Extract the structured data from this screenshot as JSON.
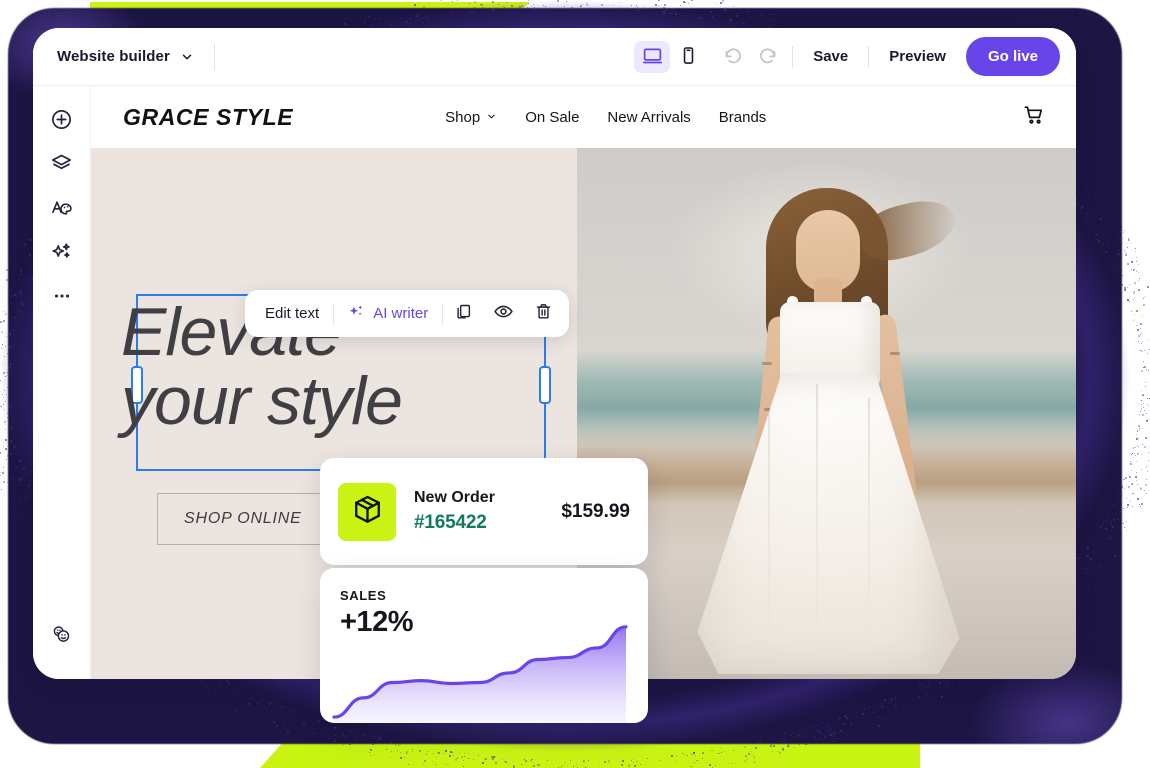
{
  "app": {
    "title": "Website builder",
    "title_chevron_icon": "chevron-down-icon"
  },
  "toolbar": {
    "desktop_view_icon": "desktop-monitor-icon",
    "mobile_view_icon": "mobile-phone-icon",
    "undo_icon": "undo-arrow-icon",
    "redo_icon": "redo-arrow-icon",
    "save_label": "Save",
    "preview_label": "Preview",
    "go_live_label": "Go live",
    "accent_color": "#6845e8",
    "active_view": "desktop"
  },
  "sidebar": {
    "items": [
      {
        "name": "add-element",
        "icon": "plus-circle-icon"
      },
      {
        "name": "layers",
        "icon": "layers-icon"
      },
      {
        "name": "design",
        "icon": "text-palette-icon"
      },
      {
        "name": "ai-tools",
        "icon": "sparkles-icon"
      },
      {
        "name": "more",
        "icon": "ellipsis-icon"
      }
    ],
    "bottom_item": {
      "name": "feedback",
      "icon": "smiley-faces-icon"
    }
  },
  "site": {
    "brand": "GRACE STYLE",
    "nav": [
      {
        "label": "Shop",
        "has_dropdown": true,
        "icon": "chevron-down-icon"
      },
      {
        "label": "On Sale",
        "has_dropdown": false
      },
      {
        "label": "New Arrivals",
        "has_dropdown": false
      },
      {
        "label": "Brands",
        "has_dropdown": false
      }
    ],
    "cart_icon": "shopping-cart-icon",
    "hero": {
      "title_line_1": "Elevate",
      "title_line_2": "your style",
      "cta_label": "SHOP ONLINE",
      "background_color": "#ece5df"
    }
  },
  "edit_toolbar": {
    "edit_text_label": "Edit text",
    "ai_writer_label": "AI writer",
    "ai_writer_icon": "sparkles-icon",
    "ai_writer_color": "#6845e8",
    "duplicate_icon": "copy-duplicate-icon",
    "visibility_icon": "eye-icon",
    "delete_icon": "trash-icon"
  },
  "order_card": {
    "icon": "package-box-icon",
    "icon_bg": "#c9f312",
    "title": "New Order",
    "order_number": "#165422",
    "order_number_color": "#0f7a5e",
    "amount": "$159.99"
  },
  "chart_data": {
    "type": "area",
    "title": "SALES",
    "value_label": "+12%",
    "line_color": "#6845e8",
    "fill_gradient": [
      "#8f6ff0",
      "#f3efff"
    ],
    "x": [
      0,
      1,
      2,
      3,
      4,
      5,
      6,
      7,
      8,
      9,
      10
    ],
    "values": [
      2,
      22,
      38,
      40,
      37,
      38,
      48,
      62,
      64,
      74,
      96
    ],
    "xlabel": "",
    "ylabel": "",
    "ylim": [
      0,
      100
    ],
    "grid": false,
    "legend": "none"
  },
  "decor": {
    "lime_color": "#c9f312",
    "frame_color": "#1d1543"
  }
}
